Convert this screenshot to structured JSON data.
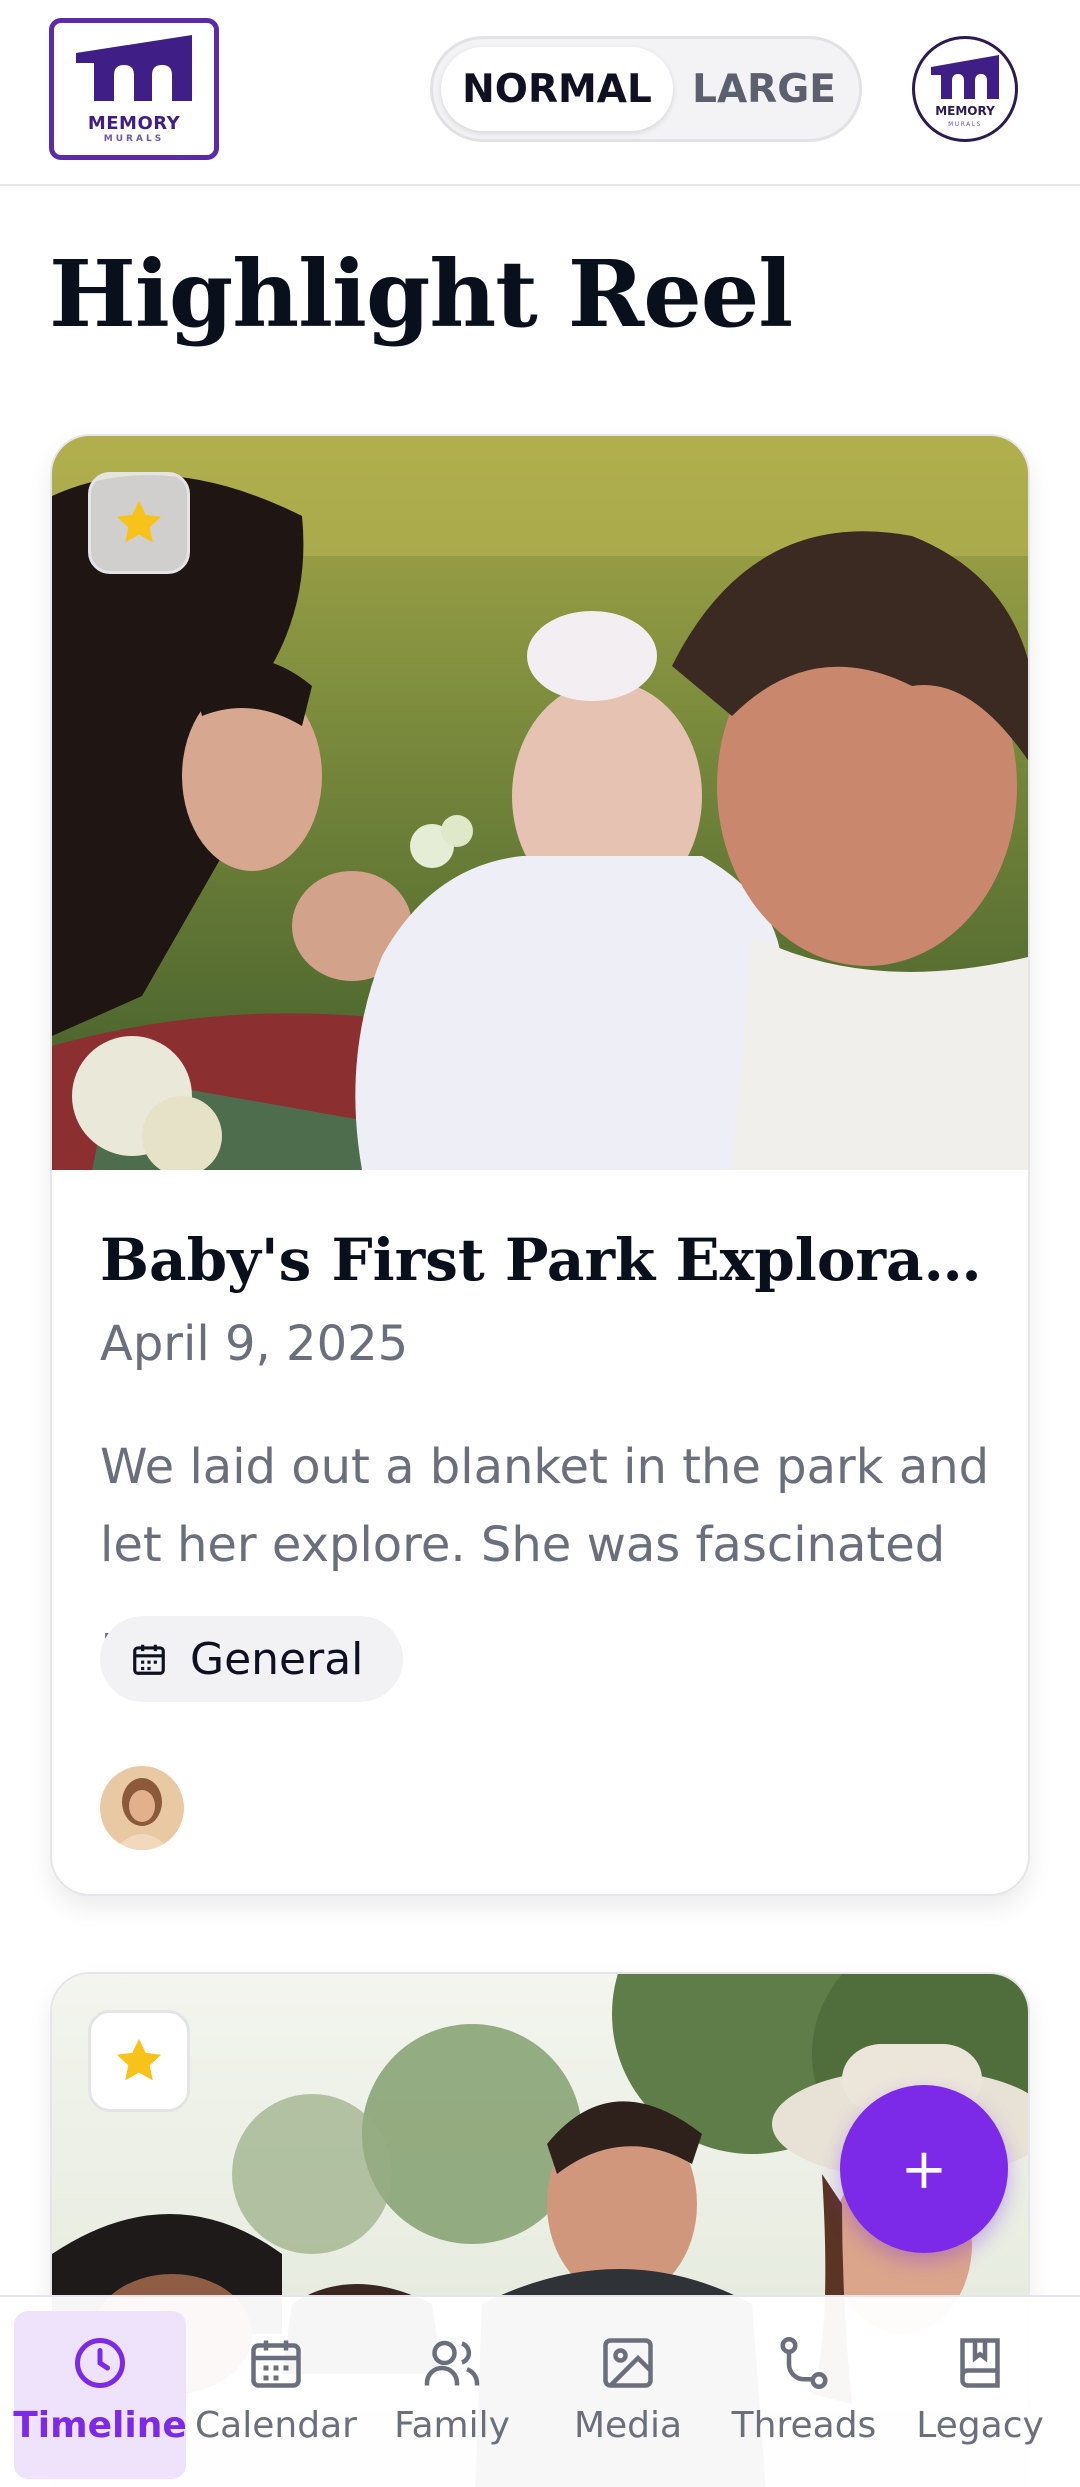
{
  "header": {
    "logo": {
      "main": "MEMORY",
      "sub": "MURALS"
    },
    "text_size_toggle": {
      "options": [
        "NORMAL",
        "LARGE"
      ],
      "selected": "NORMAL"
    },
    "profile_logo": {
      "main": "MEMORY",
      "sub": "MURALS"
    }
  },
  "page": {
    "title": "Highlight Reel"
  },
  "cards": [
    {
      "title": "Baby's First Park Exploration...",
      "date": "April 9, 2025",
      "description": "We laid out a blanket in the park and let her explore. She was fascinated ...",
      "tag": {
        "icon": "calendar-icon",
        "label": "General"
      },
      "favorite": true
    },
    {
      "favorite": true
    }
  ],
  "fab": {
    "label": "+"
  },
  "nav": {
    "items": [
      {
        "label": "Timeline",
        "icon": "clock-icon",
        "active": true
      },
      {
        "label": "Calendar",
        "icon": "calendar-icon",
        "active": false
      },
      {
        "label": "Family",
        "icon": "users-icon",
        "active": false
      },
      {
        "label": "Media",
        "icon": "image-icon",
        "active": false
      },
      {
        "label": "Threads",
        "icon": "route-icon",
        "active": false
      },
      {
        "label": "Legacy",
        "icon": "book-icon",
        "active": false
      }
    ]
  },
  "colors": {
    "accent": "#7c2ae8",
    "brand": "#5b2aa6",
    "star": "#f7c21a",
    "muted_text": "#6b6f7b"
  }
}
